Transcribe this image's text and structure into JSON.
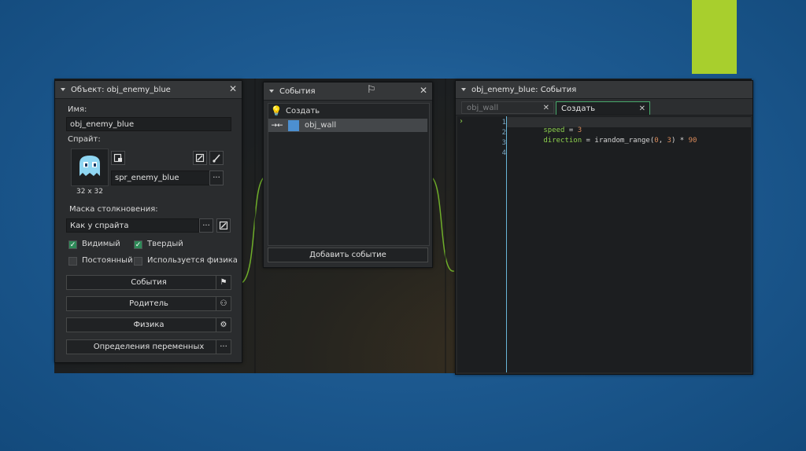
{
  "colors": {
    "accent": "#a8cf2d",
    "panel": "#2a2c2e",
    "keyword": "#8ccf4d",
    "number": "#d98a5a",
    "ident": "#7fc3ee"
  },
  "object_panel": {
    "title": "Объект: obj_enemy_blue",
    "name_label": "Имя:",
    "name_value": "obj_enemy_blue",
    "sprite_label": "Спрайт:",
    "sprite_size": "32 x 32",
    "sprite_value": "spr_enemy_blue",
    "mask_label": "Маска столкновения:",
    "mask_value": "Как у спрайта",
    "dots": "···",
    "visible_label": "Видимый",
    "visible_checked": true,
    "solid_label": "Твердый",
    "solid_checked": true,
    "persistent_label": "Постоянный",
    "persistent_checked": false,
    "physics_label": "Используется физика",
    "physics_checked": false,
    "events_button": "События",
    "parent_button": "Родитель",
    "physics_button": "Физика",
    "variables_button": "Определения переменных"
  },
  "events_panel": {
    "title": "События",
    "items": [
      {
        "label": "Создать",
        "icon": "lightbulb-icon"
      },
      {
        "label": "obj_wall",
        "icon": "collision-icon"
      }
    ],
    "add_button": "Добавить событие"
  },
  "code_panel": {
    "title": "obj_enemy_blue: События",
    "tabs": [
      {
        "label": "obj_wall",
        "active": false
      },
      {
        "label": "Создать",
        "active": true
      }
    ],
    "line_numbers": [
      "1",
      "2",
      "3",
      "4"
    ],
    "line1": {
      "ident": "speed",
      "op": " = ",
      "num": "3"
    },
    "line2": {
      "ident": "direction",
      "op": " = ",
      "func": "irandom_range(",
      "a": "0",
      "comma": ", ",
      "b": "3",
      "close": ") * ",
      "c": "90"
    }
  }
}
